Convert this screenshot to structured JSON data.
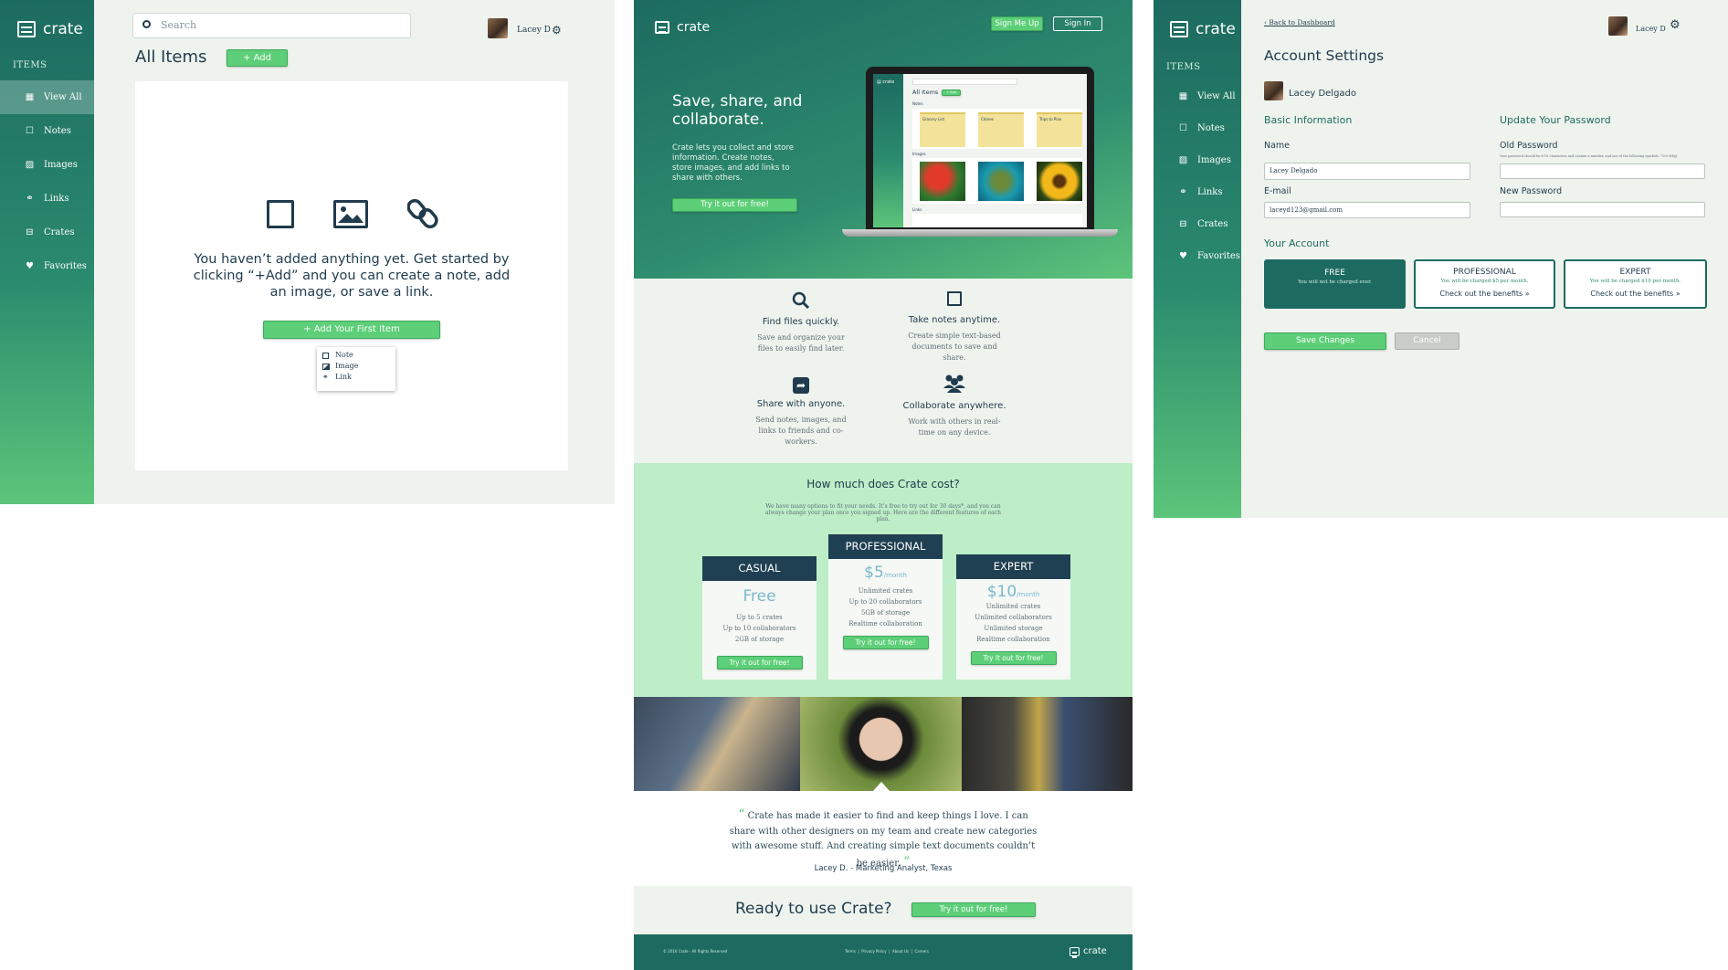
{
  "colors": {
    "primary": "#1d6b60",
    "accent": "#5ccf78",
    "dark": "#1f3f52",
    "page_bg": "#eff3ee",
    "mint": "#bdeec8"
  },
  "dashboard": {
    "logo": "crate",
    "sidebar_heading": "ITEMS",
    "sidebar_items": [
      {
        "label": "View All",
        "icon": "grid-icon"
      },
      {
        "label": "Notes",
        "icon": "note-icon"
      },
      {
        "label": "Images",
        "icon": "image-icon"
      },
      {
        "label": "Links",
        "icon": "link-icon"
      },
      {
        "label": "Crates",
        "icon": "crate-icon"
      },
      {
        "label": "Favorites",
        "icon": "heart-icon"
      }
    ],
    "search_placeholder": "Search",
    "user_name": "Lacey D",
    "page_title": "All Items",
    "add_button": "+ Add",
    "empty_message": "You haven’t added anything yet. Get started by clicking “+Add” and you can create a note, add an image, or save a link.",
    "first_item_button": "+ Add Your First Item",
    "menu_items": [
      "Note",
      "Image",
      "Link"
    ]
  },
  "landing": {
    "logo": "crate",
    "signup": "Sign Me Up",
    "signin": "Sign In",
    "hero_title": "Save, share, and collaborate.",
    "hero_text": "Crate lets you collect and store information. Create notes, store images, and add links to share with others.",
    "hero_cta": "Try it out for free!",
    "mockup": {
      "title": "All Items",
      "add": "+ Add",
      "notes_label": "Notes",
      "images_label": "Images",
      "links_label": "Links",
      "notes": [
        "Grocery List",
        "Chores",
        "Trips to Plan"
      ]
    },
    "features": [
      {
        "title": "Find files quickly.",
        "text": "Save and organize your files to easily find later.",
        "icon": "search-icon"
      },
      {
        "title": "Take notes anytime.",
        "text": "Create simple text-based documents to save and share.",
        "icon": "note-icon"
      },
      {
        "title": "Share with anyone.",
        "text": "Send notes, images, and links to friends and co-workers.",
        "icon": "share-icon"
      },
      {
        "title": "Collaborate anywhere.",
        "text": "Work with others in real-time on any device.",
        "icon": "users-icon"
      }
    ],
    "pricing_title": "How much does Crate cost?",
    "pricing_text": "We have many options to fit your needs. It’s free to try out for 30 days*, and you can always change your plan once you signed up. Here are the different features of each plan.",
    "plans": [
      {
        "name": "CASUAL",
        "price": "Free",
        "per": "",
        "features": [
          "Up to 5 crates",
          "Up to 10 collaborators",
          "2GB of storage"
        ],
        "cta": "Try it out for free!"
      },
      {
        "name": "PROFESSIONAL",
        "price": "$5",
        "per": "/month",
        "features": [
          "Unlimited crates",
          "Up to 20 collaborators",
          "5GB of storage",
          "Realtime collaboration"
        ],
        "cta": "Try it out for free!"
      },
      {
        "name": "EXPERT",
        "price": "$10",
        "per": "/month",
        "features": [
          "Unlimited crates",
          "Unlimited collaborators",
          "Unlimited storage",
          "Realtime collaboration"
        ],
        "cta": "Try it out for free!"
      }
    ],
    "testimonial": "Crate has made it easier to find and keep things I love. I can share with other designers on my team and create new categories with awesome stuff. And creating simple text documents couldn’t be easier.",
    "testimonial_author": "Lacey D. - Marketing Analyst, Texas",
    "ready_title": "Ready to use Crate?",
    "ready_cta": "Try it out for free!",
    "footer_copy": "© 2016 Crate · All Rights Reserved",
    "footer_links": "Terms  |  Privacy Policy  |  About Us  |  Careers",
    "footer_logo": "crate"
  },
  "settings": {
    "logo": "crate",
    "sidebar_heading": "ITEMS",
    "sidebar_items": [
      {
        "label": "View All",
        "icon": "grid-icon"
      },
      {
        "label": "Notes",
        "icon": "note-icon"
      },
      {
        "label": "Images",
        "icon": "image-icon"
      },
      {
        "label": "Links",
        "icon": "link-icon"
      },
      {
        "label": "Crates",
        "icon": "crate-icon"
      },
      {
        "label": "Favorites",
        "icon": "heart-icon"
      }
    ],
    "back_link": "Back to Dashboard",
    "user_name": "Lacey D",
    "page_title": "Account Settings",
    "full_name": "Lacey Delgado",
    "basic_info_title": "Basic Information",
    "name_label": "Name",
    "name_value": "Lacey Delgado",
    "email_label": "E-mail",
    "email_value": "laceyd123@gmail.com",
    "password_title": "Update Your Password",
    "old_password_label": "Old Password",
    "password_hint": "Your password should be 6-16 characters and contain a number, and one of the following symbols: *&%!#$@",
    "new_password_label": "New Password",
    "account_title": "Your Account",
    "plans": [
      {
        "name": "FREE",
        "note": "You will not be charged ever.",
        "link": ""
      },
      {
        "name": "PROFESSIONAL",
        "note": "You will be charged $5 per month.",
        "link": "Check out the benefits"
      },
      {
        "name": "EXPERT",
        "note": "You will be charged $10 per month.",
        "link": "Check out the benefits"
      }
    ],
    "save_button": "Save Changes",
    "cancel_button": "Cancel"
  }
}
